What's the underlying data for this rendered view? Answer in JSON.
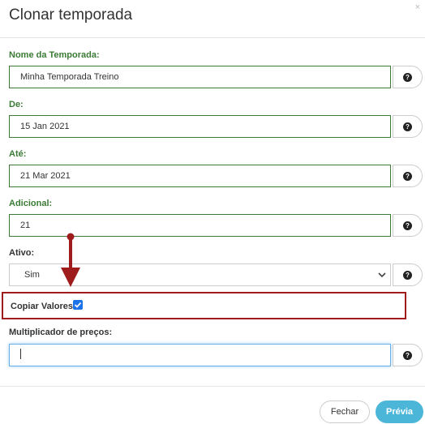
{
  "modal": {
    "title": "Clonar temporada",
    "close_glyph": "×"
  },
  "fields": {
    "nome": {
      "label": "Nome da Temporada:",
      "value": "Minha Temporada Treino"
    },
    "de": {
      "label": "De:",
      "value": "15 Jan 2021"
    },
    "ate": {
      "label": "Até:",
      "value": "21 Mar 2021"
    },
    "adicional": {
      "label": "Adicional:",
      "value": "21"
    },
    "ativo": {
      "label": "Ativo:",
      "selected": "Sim"
    },
    "copiar": {
      "label": "Copiar Valores:",
      "checked": true
    },
    "multiplicador": {
      "label": "Multiplicador de preços:",
      "value": ""
    }
  },
  "help_glyph": "?",
  "footer": {
    "close_label": "Fechar",
    "preview_label": "Prévia"
  },
  "colors": {
    "label_green": "#3b7a35",
    "highlight_red": "#9e1c1c",
    "primary": "#4cb6d9",
    "checkbox": "#1a73e8"
  },
  "icons": {
    "help": "question-circle-icon",
    "select": "chevron-down-icon",
    "annotation": "red-arrow-icon"
  }
}
